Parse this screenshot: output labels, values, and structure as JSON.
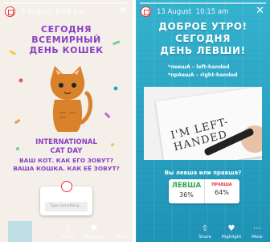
{
  "left_story": {
    "date": "6 August",
    "time": "6:09 pm",
    "headline": [
      "СЕГОДНЯ",
      "ВСЕМИРНЫЙ",
      "ДЕНЬ КОШЕК"
    ],
    "subhead": [
      "INTERNATIONAL",
      "CAT DAY"
    ],
    "question": [
      "ВАШ КОТ. КАК ЕГО ЗОВУТ?",
      "ВАША КОШКА. КАК ЕЁ ЗОВУТ?"
    ],
    "input_placeholder": "Type something...",
    "actions": {
      "share": "Share",
      "highlight": "Highlight",
      "more": "More"
    }
  },
  "right_story": {
    "date": "13 August",
    "time": "10:15 am",
    "headline": [
      "ДОБРОЕ УТРО!",
      "СЕГОДНЯ",
      "ДЕНЬ ЛЕВШИ!"
    ],
    "hints": [
      "*левшА – left-handed",
      "*прАвшА – right-handed"
    ],
    "photo_text": "I'M LEFT-HANDED",
    "poll_question": "Вы левша или правша?",
    "poll_options": [
      {
        "label": "ЛЕВША",
        "percent": "36%"
      },
      {
        "label": "ПРАВША",
        "percent": "64%"
      }
    ],
    "actions": {
      "share": "Share",
      "highlight": "Highlight",
      "more": "More"
    }
  },
  "colors": {
    "purple": "#8a3fc4",
    "teal": "#2fa8c8",
    "cat": "#d9822b"
  },
  "icons": [
    "avatar-icon",
    "close-icon",
    "share-icon",
    "highlight-icon",
    "more-icon"
  ]
}
